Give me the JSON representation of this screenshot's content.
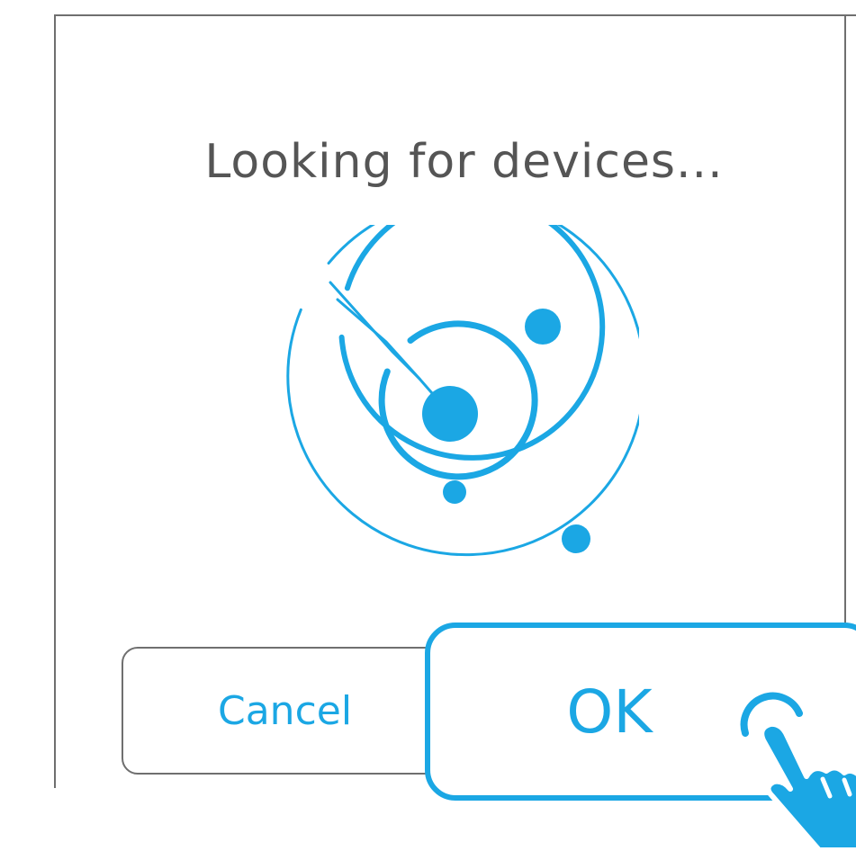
{
  "dialog": {
    "title": "Looking for devices...",
    "cancel_label": "Cancel",
    "ok_label": "OK"
  },
  "icons": {
    "radar": "radar-search-icon",
    "hand": "tap-hand-icon"
  },
  "colors": {
    "accent": "#1ba7e4",
    "text": "#555555",
    "border": "#6f6f6f"
  }
}
